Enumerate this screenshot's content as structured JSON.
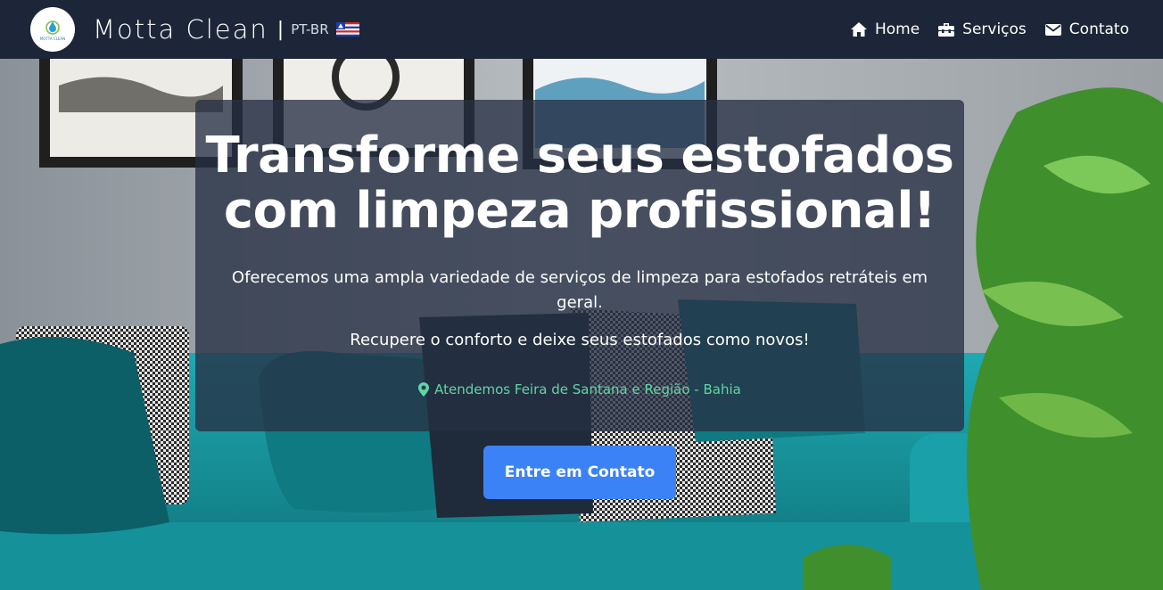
{
  "navbar": {
    "logo_text": "MOTTA CLEAN",
    "brand": "Motta Clean",
    "separator": "|",
    "lang": "PT-BR",
    "flag": "bahia-flag-icon",
    "links": [
      {
        "label": "Home",
        "icon": "home-icon"
      },
      {
        "label": "Serviços",
        "icon": "toolbox-icon"
      },
      {
        "label": "Contato",
        "icon": "envelope-icon"
      }
    ]
  },
  "hero": {
    "title_line1": "Transforme seus estofados",
    "title_line2": "com limpeza profissional!",
    "subtitle": "Oferecemos uma ampla variedade de serviços de limpeza para estofados retráteis em geral.",
    "subtitle2": "Recupere o conforto e deixe seus estofados como novos!",
    "location": "Atendemos Feira de Santana e Região - Bahia",
    "cta_label": "Entre em Contato"
  },
  "colors": {
    "navbar_bg": "#1c2638",
    "accent": "#3b82f6",
    "location": "#5fd6a4",
    "sofa": "#1a9aa3"
  }
}
